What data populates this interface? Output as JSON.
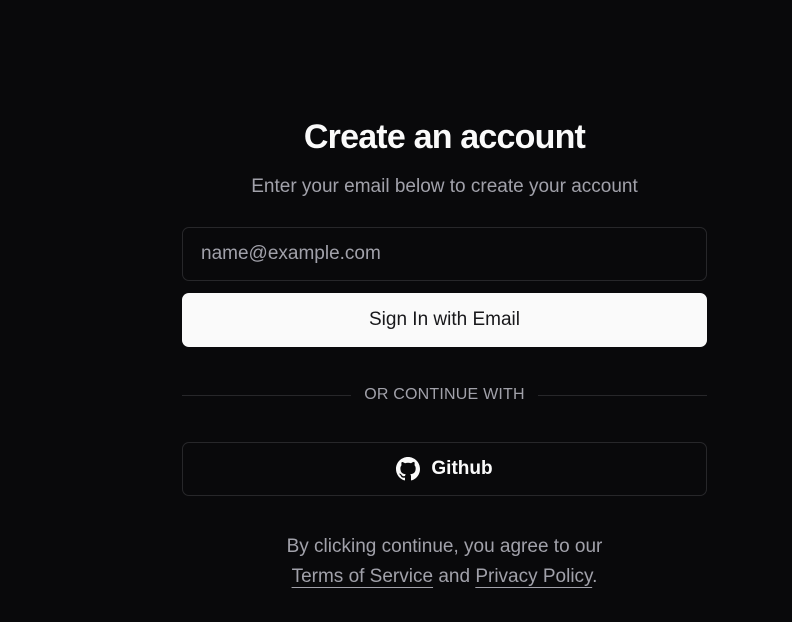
{
  "heading": {
    "title": "Create an account",
    "subtitle": "Enter your email below to create your account"
  },
  "form": {
    "email_placeholder": "name@example.com",
    "email_value": "",
    "submit_label": "Sign In with Email"
  },
  "divider": {
    "label": "OR CONTINUE WITH"
  },
  "oauth": {
    "github_label": "Github",
    "github_icon": "github-icon"
  },
  "footer": {
    "prefix": "By clicking continue, you agree to our",
    "terms_label": "Terms of Service",
    "and_text": "and",
    "privacy_label": "Privacy Policy",
    "period": "."
  },
  "colors": {
    "background": "#09090b",
    "foreground": "#fafafa",
    "muted": "#a1a1aa",
    "border": "#27272a",
    "primary_button_bg": "#fafafa",
    "primary_button_text": "#18181b"
  }
}
